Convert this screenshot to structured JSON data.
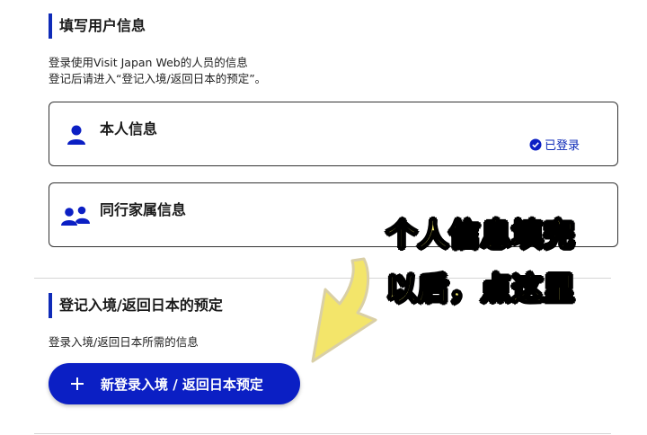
{
  "user_section": {
    "title": "填写用户信息",
    "desc_line1": "登录使用Visit Japan Web的人员的信息",
    "desc_line2": "登记后请进入“登记入境/返回日本的预定”。",
    "cards": [
      {
        "label": "本人信息",
        "status": "已登录",
        "icon": "person-icon"
      },
      {
        "label": "同行家属信息",
        "icon": "family-icon"
      }
    ]
  },
  "plan_section": {
    "title": "登记入境/返回日本的预定",
    "desc": "登录入境/返回日本所需的信息",
    "button_label": "新登录入境 / 返回日本预定"
  },
  "overlay": {
    "line1": "个人信息填完",
    "line2": "以后，点这里"
  },
  "colors": {
    "accent": "#0b1fc4",
    "overlay_text": "#f8ef6a",
    "arrow": "#f3e56a"
  }
}
